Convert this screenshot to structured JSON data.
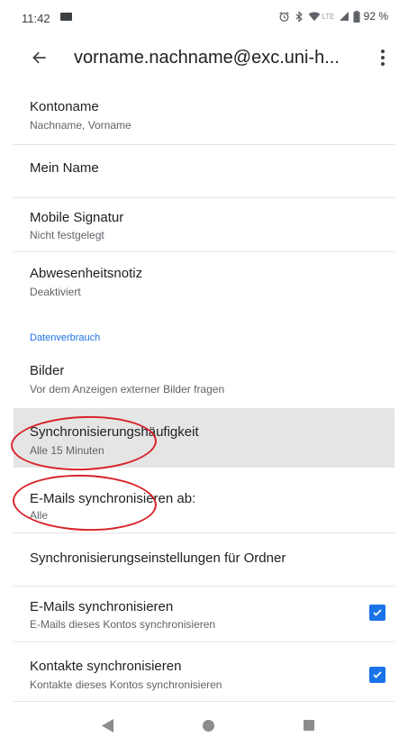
{
  "status_bar": {
    "time": "11:42",
    "network_label": "LTE",
    "battery": "92 %",
    "icons": [
      "app-notification-icon",
      "alarm-icon",
      "bluetooth-icon",
      "wifi-icon",
      "signal-icon",
      "battery-icon"
    ]
  },
  "app_bar": {
    "title": "vorname.nachname@exc.uni-h...",
    "icons": [
      "back-arrow-icon",
      "more-vert-icon"
    ]
  },
  "settings": {
    "kontoname": {
      "title": "Kontoname",
      "subtitle": "Nachname, Vorname"
    },
    "mein_name": {
      "title": "Mein Name"
    },
    "mobile_signatur": {
      "title": "Mobile Signatur",
      "subtitle": "Nicht festgelegt"
    },
    "abwesenheitsnotiz": {
      "title": "Abwesenheitsnotiz",
      "subtitle": "Deaktiviert"
    },
    "section_header": "Datenverbrauch",
    "bilder": {
      "title": "Bilder",
      "subtitle": "Vor dem Anzeigen externer Bilder fragen"
    },
    "sync_frequency": {
      "title": "Synchronisierungshäufigkeit",
      "subtitle": "Alle 15 Minuten"
    },
    "sync_from": {
      "title": "E-Mails synchronisieren ab:",
      "subtitle": "Alle"
    },
    "folder_sync": {
      "title": "Synchronisierungseinstellungen für Ordner"
    },
    "email_sync": {
      "title": "E-Mails synchronisieren",
      "subtitle": "E-Mails dieses Kontos synchronisieren",
      "checked": true
    },
    "contacts_sync": {
      "title": "Kontakte synchronisieren",
      "subtitle": "Kontakte dieses Kontos synchronisieren",
      "checked": true
    }
  },
  "annotations": {
    "color": "#d8232a",
    "circled_items": [
      "Synchronisierungshäufigkeit",
      "E-Mails synchronisieren ab:"
    ]
  },
  "colors": {
    "accent": "#1a73e8",
    "highlight_row": "#e5e5e5"
  },
  "nav_bar": {
    "icons": [
      "nav-back-icon",
      "nav-home-icon",
      "nav-recents-icon"
    ]
  }
}
